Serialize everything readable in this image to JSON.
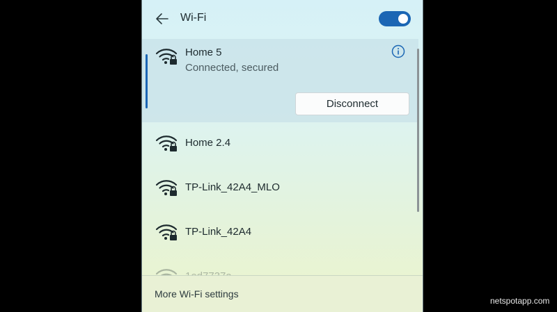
{
  "header": {
    "title": "Wi-Fi",
    "wifi_toggle": "on",
    "accent_color": "#1b66b4"
  },
  "networks": [
    {
      "name": "Home 5",
      "status": "Connected, secured",
      "icon": "wifi-secured-icon",
      "action": "Disconnect"
    },
    {
      "name": "Home 2.4",
      "icon": "wifi-secured-icon"
    },
    {
      "name": "TP-Link_42A4_MLO",
      "icon": "wifi-secured-icon"
    },
    {
      "name": "TP-Link_42A4",
      "icon": "wifi-secured-icon"
    },
    {
      "name": "1ed7737a",
      "icon": "wifi-secured-icon"
    }
  ],
  "footer": {
    "settings_link": "More Wi-Fi settings"
  },
  "watermark": "netspotapp.com"
}
